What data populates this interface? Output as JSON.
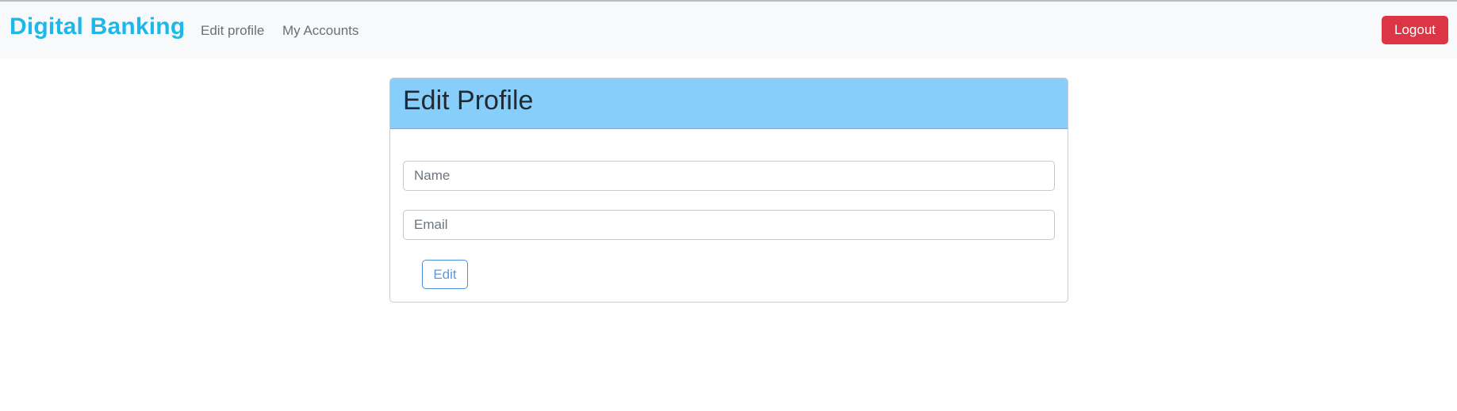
{
  "navbar": {
    "brand": "Digital Banking",
    "links": [
      {
        "label": "Edit profile"
      },
      {
        "label": "My Accounts"
      }
    ],
    "logout_label": "Logout"
  },
  "card": {
    "title": "Edit Profile",
    "fields": {
      "name": {
        "value": "",
        "placeholder": "Name"
      },
      "email": {
        "value": "",
        "placeholder": "Email"
      }
    },
    "submit_label": "Edit"
  },
  "colors": {
    "brand": "#1cb8ea",
    "navbar_bg": "#f8f9fa",
    "logout_bg": "#dc3545",
    "card_header_bg": "#87cefa",
    "edit_button_border": "#4a90d9"
  }
}
